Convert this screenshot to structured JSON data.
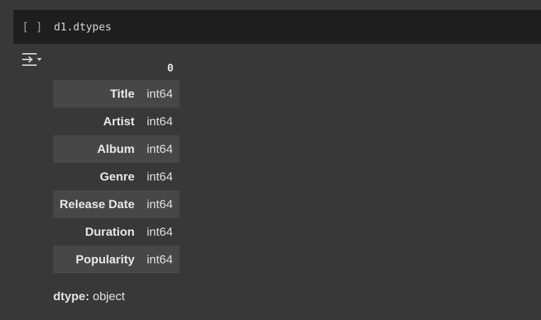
{
  "cell": {
    "run_indicator": "[ ]",
    "code": "d1.dtypes"
  },
  "output": {
    "table": {
      "column_header": "0",
      "rows": [
        {
          "index": "Title",
          "value": "int64"
        },
        {
          "index": "Artist",
          "value": "int64"
        },
        {
          "index": "Album",
          "value": "int64"
        },
        {
          "index": "Genre",
          "value": "int64"
        },
        {
          "index": "Release Date",
          "value": "int64"
        },
        {
          "index": "Duration",
          "value": "int64"
        },
        {
          "index": "Popularity",
          "value": "int64"
        }
      ]
    },
    "dtype_label": "dtype:",
    "dtype_value": "object"
  },
  "icons": {
    "output_toggle": "output-collapse-icon"
  },
  "colors": {
    "background": "#383838",
    "cell_input_bg": "#1e1e1e",
    "row_stripe": "#474747",
    "text": "#e3e3e3"
  }
}
